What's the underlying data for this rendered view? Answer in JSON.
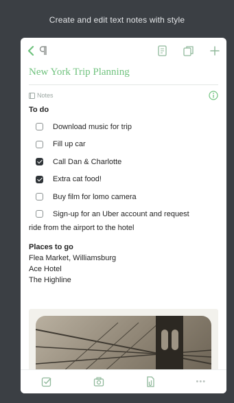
{
  "banner": {
    "text": "Create and edit text notes with style"
  },
  "note": {
    "title": "New York Trip Planning",
    "notebook": "Notes"
  },
  "todo": {
    "heading": "To do",
    "items": [
      {
        "label": "Download music for trip",
        "checked": false
      },
      {
        "label": "Fill up car",
        "checked": false
      },
      {
        "label": "Call Dan & Charlotte",
        "checked": true
      },
      {
        "label": "Extra cat food!",
        "checked": true
      },
      {
        "label": "Buy film for lomo camera",
        "checked": false
      }
    ],
    "long_item": {
      "label_first": "Sign-up for an Uber account and request",
      "label_rest": "ride from the airport to the hotel",
      "checked": false
    }
  },
  "places": {
    "heading": "Places to go",
    "items": [
      "Flea Market, Williamsburg",
      "Ace Hotel",
      "The Highline"
    ]
  },
  "colors": {
    "accent": "#6fc27d",
    "background": "#3b3f44",
    "icon": "#8fb89a"
  },
  "icons": {
    "back": "chevron-left-icon",
    "format": "paragraph-icon",
    "reminder": "note-edit-icon",
    "share": "share-note-icon",
    "add": "plus-icon",
    "info": "info-icon",
    "checkbox": "checkbox-icon",
    "camera": "camera-icon",
    "attach": "attachment-icon",
    "more": "more-icon"
  },
  "toolbar": {
    "more_label": "•••"
  }
}
